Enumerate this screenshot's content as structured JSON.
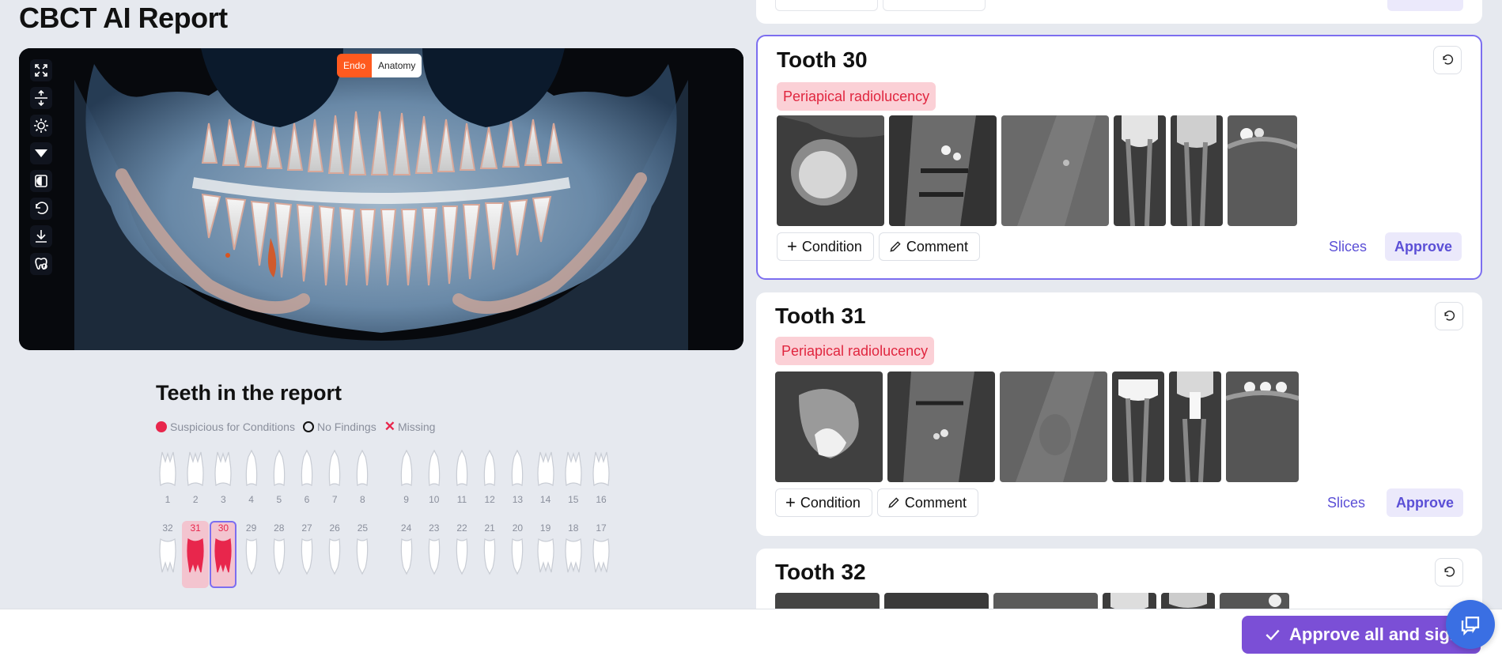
{
  "page": {
    "title": "CBCT AI Report"
  },
  "viewer": {
    "modes": [
      {
        "label": "Endo",
        "active": true
      },
      {
        "label": "Anatomy",
        "active": false
      }
    ],
    "tools": [
      "expand-icon",
      "split-vertical-icon",
      "brightness-icon",
      "filter-icon",
      "invert-icon",
      "undo-icon",
      "download-icon",
      "tooth-mask-icon"
    ]
  },
  "teeth_chart": {
    "title": "Teeth in the report",
    "legend": {
      "suspicious": "Suspicious for Conditions",
      "no_findings": "No Findings",
      "missing": "Missing"
    },
    "upper": [
      "1",
      "2",
      "3",
      "4",
      "5",
      "6",
      "7",
      "8",
      "9",
      "10",
      "11",
      "12",
      "13",
      "14",
      "15",
      "16"
    ],
    "lower": [
      "32",
      "31",
      "30",
      "29",
      "28",
      "27",
      "26",
      "25",
      "24",
      "23",
      "22",
      "21",
      "20",
      "19",
      "18",
      "17"
    ],
    "highlighted": {
      "31": "suspicious",
      "30": "selected"
    }
  },
  "cards": [
    {
      "title": "Tooth 30",
      "condition": "Periapical radiolucency",
      "add_condition": "Condition",
      "comment": "Comment",
      "slices": "Slices",
      "approve": "Approve",
      "selected": true
    },
    {
      "title": "Tooth 31",
      "condition": "Periapical radiolucency",
      "add_condition": "Condition",
      "comment": "Comment",
      "slices": "Slices",
      "approve": "Approve",
      "selected": false
    },
    {
      "title": "Tooth 32"
    }
  ],
  "footer": {
    "approve_all": "Approve all and sign"
  },
  "colors": {
    "accent": "#7b4fd6",
    "danger": "#e8264c",
    "endo": "#ff5a1f",
    "selected_border": "#7c6ef0"
  }
}
